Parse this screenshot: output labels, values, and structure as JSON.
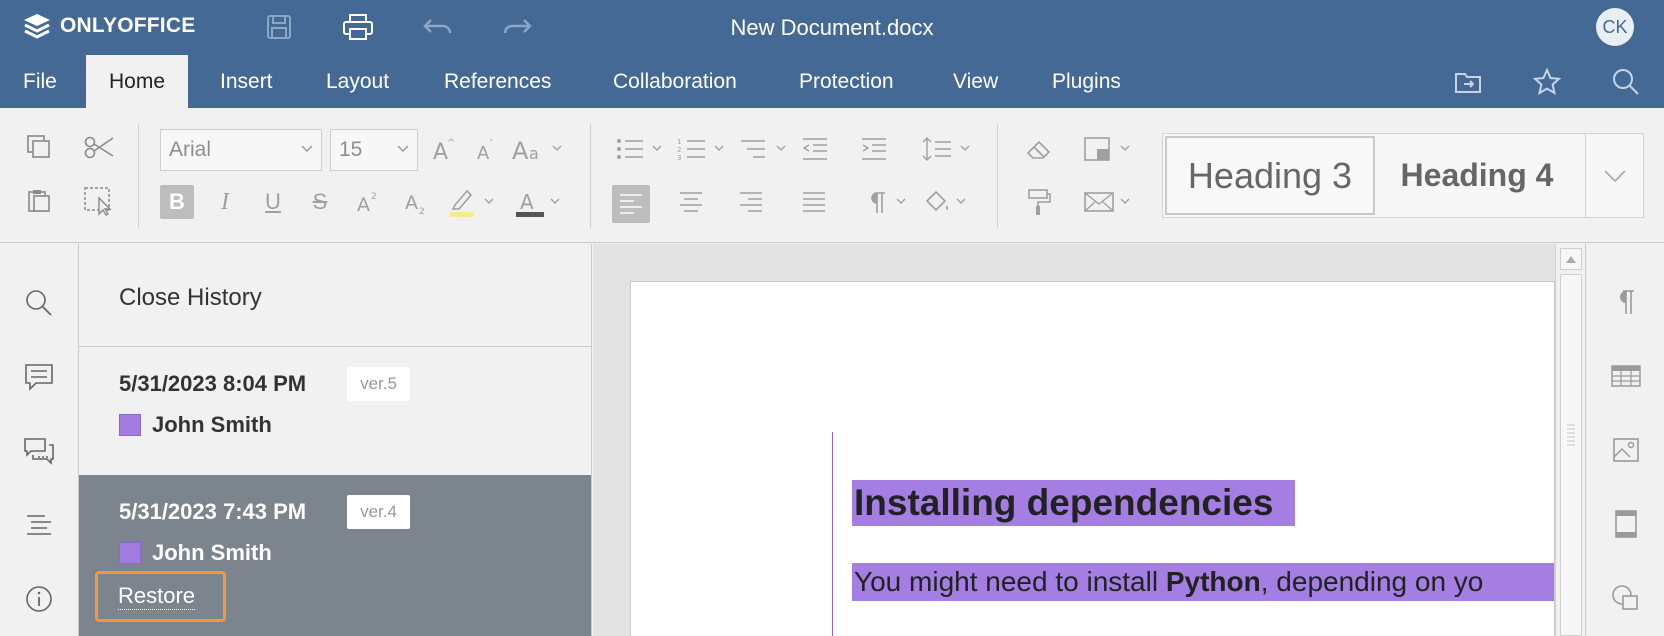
{
  "app": {
    "logo_text": "ONLYOFFICE",
    "doc_title": "New Document.docx",
    "user_initials": "CK"
  },
  "tabs": [
    {
      "label": "File"
    },
    {
      "label": "Home"
    },
    {
      "label": "Insert"
    },
    {
      "label": "Layout"
    },
    {
      "label": "References"
    },
    {
      "label": "Collaboration"
    },
    {
      "label": "Protection"
    },
    {
      "label": "View"
    },
    {
      "label": "Plugins"
    }
  ],
  "active_tab": "Home",
  "toolbar": {
    "font_name": "Arial",
    "font_size": "15",
    "styles": [
      {
        "label": "Heading 3"
      },
      {
        "label": "Heading 4"
      }
    ],
    "bold_glyph": "B",
    "italic_glyph": "I",
    "underline_glyph": "U",
    "strike_glyph": "S"
  },
  "history": {
    "close_label": "Close History",
    "versions": [
      {
        "date": "5/31/2023 8:04 PM",
        "badge": "ver.5",
        "user": "John Smith",
        "selected": false
      },
      {
        "date": "5/31/2023 7:43 PM",
        "badge": "ver.4",
        "user": "John Smith",
        "selected": true
      }
    ],
    "restore_label": "Restore"
  },
  "document": {
    "heading": "Installing dependencies",
    "para_pre": "You might need to install ",
    "para_bold": "Python",
    "para_post": ", depending on yo"
  },
  "colors": {
    "brand": "#446995",
    "highlight": "#a47ee2",
    "author": "#a17be0",
    "selected_version": "#7c848e",
    "restore_outline": "#f2963f"
  }
}
